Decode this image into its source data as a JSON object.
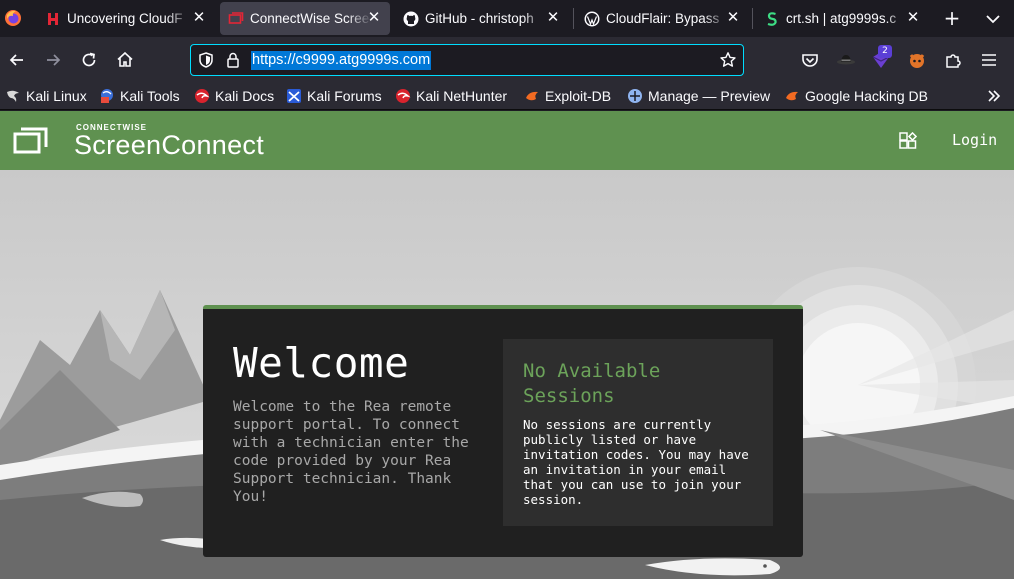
{
  "browser": {
    "tabs": [
      {
        "title": "Uncovering CloudF",
        "favicon": "h-logo-icon",
        "active": false
      },
      {
        "title": "ConnectWise Scree",
        "favicon": "screenconnect-icon",
        "active": true
      },
      {
        "title": "GitHub - christoph",
        "favicon": "github-icon",
        "active": false
      },
      {
        "title": "CloudFlair: Bypass",
        "favicon": "wordpress-icon",
        "active": false
      },
      {
        "title": "crt.sh | atg9999s.c",
        "favicon": "crtsh-icon",
        "active": false
      }
    ],
    "url": "https://c9999.atg9999s.com",
    "extension_badge": "2",
    "bookmarks": [
      {
        "label": "Kali Linux",
        "icon": "kali-dragon-icon"
      },
      {
        "label": "Kali Tools",
        "icon": "kali-tools-icon"
      },
      {
        "label": "Kali Docs",
        "icon": "kali-docs-icon"
      },
      {
        "label": "Kali Forums",
        "icon": "kali-forums-icon"
      },
      {
        "label": "Kali NetHunter",
        "icon": "kali-nethunter-icon"
      },
      {
        "label": "Exploit-DB",
        "icon": "exploit-db-icon"
      },
      {
        "label": "Manage — Preview",
        "icon": "manage-icon"
      },
      {
        "label": "Google Hacking DB",
        "icon": "ghdb-icon"
      }
    ],
    "colors": {
      "accent": "#00ddff",
      "selection": "#0078d7"
    }
  },
  "site": {
    "brand_small": "CONNECTWISE",
    "brand": "ScreenConnect",
    "login": "Login",
    "colors": {
      "header": "#5f9150",
      "panel_title": "#6ca35a"
    }
  },
  "card": {
    "heading": "Welcome",
    "intro": "Welcome to the Rea remote support portal. To connect with a technician enter the code provided by your Rea Support technician. Thank You!",
    "panel_title": "No Available Sessions",
    "panel_text": "No sessions are currently publicly listed or have invitation codes. You may have an invitation in your email that you can use to join your session."
  }
}
